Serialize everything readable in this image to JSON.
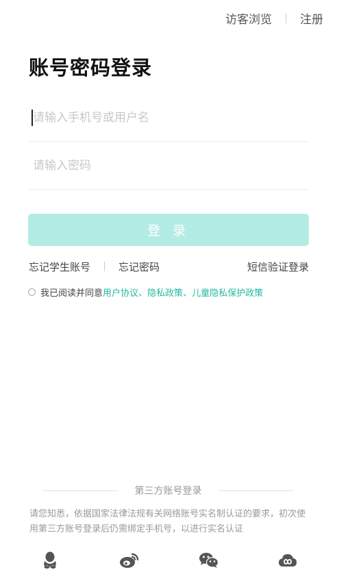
{
  "header": {
    "guest_label": "访客浏览",
    "register_label": "注册"
  },
  "title": "账号密码登录",
  "form": {
    "username_placeholder": "请输入手机号或用户名",
    "password_placeholder": "请输入密码",
    "login_label": "登 录"
  },
  "links": {
    "forgot_student": "忘记学生账号",
    "forgot_password": "忘记密码",
    "sms_login": "短信验证登录"
  },
  "agreement": {
    "prefix": "我已阅读并同意",
    "user_agreement": "用户协议",
    "sep1": "、",
    "privacy_policy": "隐私政策",
    "sep2": "、",
    "child_privacy": "儿童隐私保护政策"
  },
  "third_party": {
    "title": "第三方账号登录",
    "notice": "请您知悉，依据国家法律法规有关网络账号实名制认证的要求，初次使用第三方账号登录后仍需绑定手机号，以进行实名认证",
    "icons": [
      "qq-icon",
      "weibo-icon",
      "wechat-icon",
      "cloud-icon"
    ]
  },
  "colors": {
    "accent": "#26b8a0",
    "button_disabled": "#b3ece4",
    "icon": "#555555"
  }
}
